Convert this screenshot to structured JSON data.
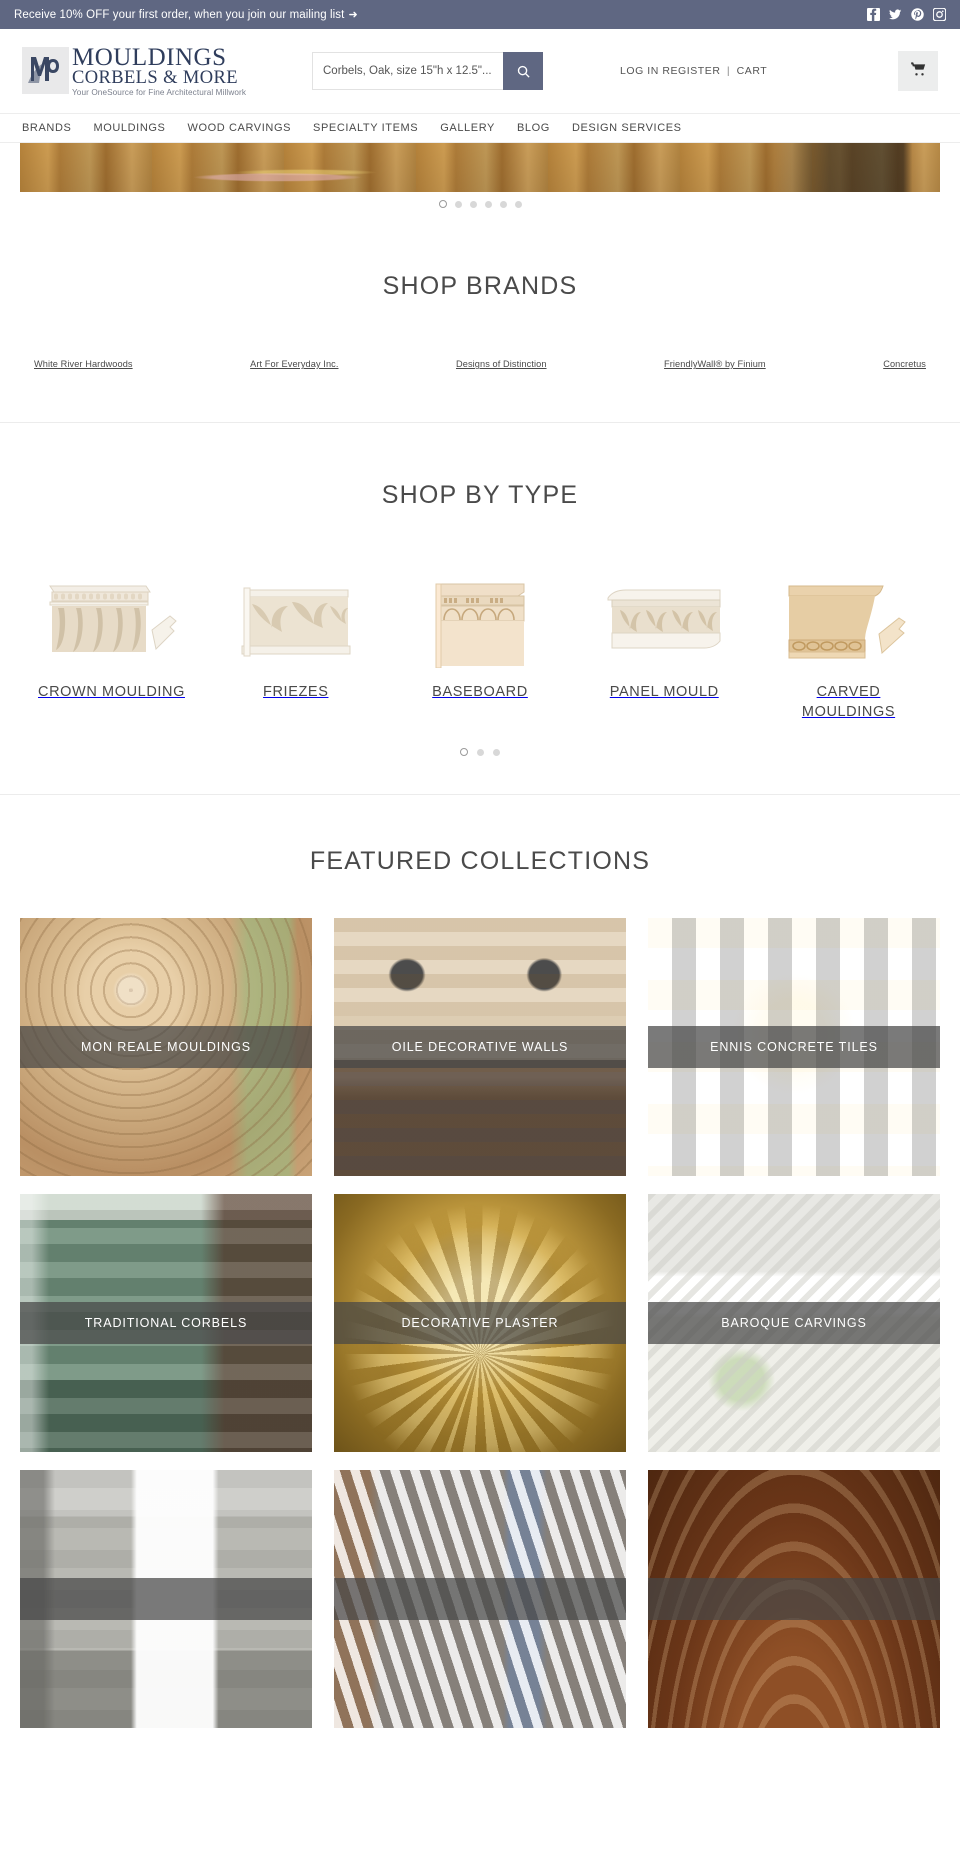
{
  "announcement": {
    "text": "Receive 10% OFF your first order, when you join our mailing list",
    "arrow": "➜",
    "social": [
      {
        "name": "facebook-icon",
        "label": "Facebook"
      },
      {
        "name": "twitter-icon",
        "label": "Twitter"
      },
      {
        "name": "pinterest-icon",
        "label": "Pinterest"
      },
      {
        "name": "instagram-icon",
        "label": "Instagram"
      }
    ],
    "bg_color": "#5f6782"
  },
  "header": {
    "logo": {
      "line1": "MOULDINGS",
      "line2": "CORBELS & MORE",
      "tagline": "Your OneSource for Fine Architectural Millwork",
      "mark_alt": "M&C monogram",
      "color": "#2f3d5c"
    },
    "search": {
      "value": "Corbels, Oak, size 15\"h x 12.5\"...",
      "placeholder": "Search the store",
      "button_icon": "search-icon",
      "button_color": "#5f6782"
    },
    "account": {
      "login": "LOG IN",
      "register": "REGISTER",
      "separator": "|",
      "cart": "CART"
    },
    "cart_button": {
      "icon": "shopping-cart-icon"
    }
  },
  "nav": {
    "items": [
      {
        "label": "BRANDS"
      },
      {
        "label": "MOULDINGS"
      },
      {
        "label": "WOOD CARVINGS"
      },
      {
        "label": "SPECIALTY ITEMS"
      },
      {
        "label": "GALLERY"
      },
      {
        "label": "BLOG"
      },
      {
        "label": "DESIGN SERVICES"
      }
    ]
  },
  "hero": {
    "alt": "Wood kitchen cabinetry banner",
    "dots": 6,
    "active_dot": 1
  },
  "shop_brands": {
    "title": "SHOP BRANDS",
    "brands": [
      {
        "label": "White River Hardwoods"
      },
      {
        "label": "Art For Everyday Inc."
      },
      {
        "label": "Designs of Distinction"
      },
      {
        "label": "FriendlyWall® by Finium"
      },
      {
        "label": "Concretus"
      }
    ]
  },
  "shop_by_type": {
    "title": "SHOP BY TYPE",
    "items": [
      {
        "label": "CROWN MOULDING",
        "art": "crown"
      },
      {
        "label": "FRIEZES",
        "art": "frieze"
      },
      {
        "label": "BASEBOARD",
        "art": "baseboard"
      },
      {
        "label": "PANEL MOULD",
        "art": "panel"
      },
      {
        "label": "CARVED MOULDINGS",
        "art": "carved"
      }
    ],
    "dots": 3,
    "active_dot": 1
  },
  "featured_collections": {
    "title": "FEATURED COLLECTIONS",
    "cards": [
      {
        "label": "MON REALE MOULDINGS",
        "art": "img-monreale"
      },
      {
        "label": "OILE DECORATIVE WALLS",
        "art": "img-oile"
      },
      {
        "label": "ENNIS CONCRETE TILES",
        "art": "img-ennis"
      },
      {
        "label": "TRADITIONAL CORBELS",
        "art": "img-corbels"
      },
      {
        "label": "DECORATIVE PLASTER",
        "art": "img-plaster"
      },
      {
        "label": "BAROQUE CARVINGS",
        "art": "img-baroque"
      },
      {
        "label": "",
        "art": "img-kitchen"
      },
      {
        "label": "",
        "art": "img-profiles"
      },
      {
        "label": "",
        "art": "img-arch"
      }
    ]
  }
}
